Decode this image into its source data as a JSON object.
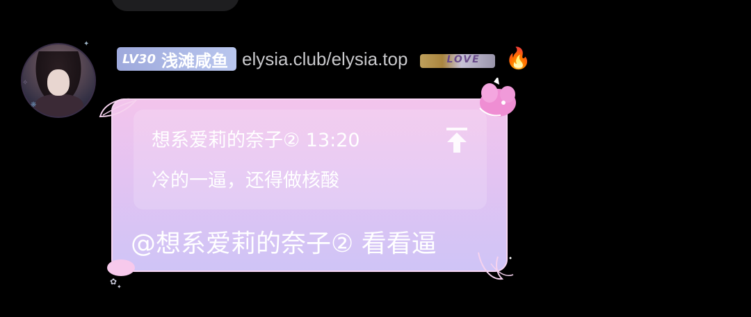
{
  "user": {
    "level": "LV30",
    "nickname": "浅滩咸鱼",
    "title": "elysia.club/elysia.top",
    "tag_label": "LOVE",
    "fire_emoji": "🔥"
  },
  "quote": {
    "header": "想系爱莉的奈子② 13:20",
    "text": "冷的一逼，还得做核酸"
  },
  "message": {
    "text": "@想系爱莉的奈子② 看看逼"
  },
  "colors": {
    "background": "#000000",
    "badge": "#aab6e6",
    "bubble_top": "#f3c4ec",
    "bubble_bottom": "#cfc4f6"
  },
  "icons": [
    "avatar",
    "love-tag-icon",
    "fire-icon",
    "scroll-to-source-icon",
    "unicorn-deco-icon",
    "leaf-deco-icon"
  ]
}
